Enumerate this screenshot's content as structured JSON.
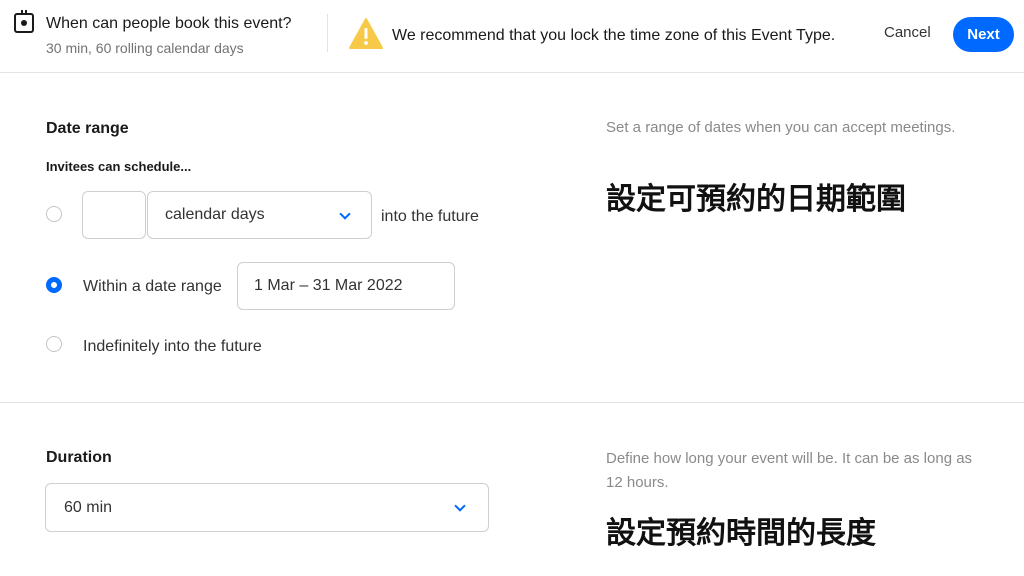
{
  "header": {
    "title": "When can people book this event?",
    "subtitle": "30 min, 60 rolling calendar days",
    "warning": "We recommend that you lock the time zone of this Event Type.",
    "cancel_label": "Cancel",
    "next_label": "Next"
  },
  "date_range": {
    "title": "Date range",
    "invitees_label": "Invitees can schedule...",
    "help": "Set a range of dates when you can accept meetings.",
    "annotation": "設定可預約的日期範圍",
    "options": {
      "rolling": {
        "days_value": "",
        "unit": "calendar days",
        "suffix": "into the future",
        "selected": false
      },
      "within": {
        "label": "Within a date range",
        "range_value": "1 Mar – 31 Mar 2022",
        "selected": true
      },
      "indefinite": {
        "label": "Indefinitely into the future",
        "selected": false
      }
    }
  },
  "duration": {
    "title": "Duration",
    "value": "60 min",
    "help": "Define how long your event will be. It can be as long as 12 hours.",
    "annotation": "設定預約時間的長度"
  },
  "colors": {
    "accent": "#0069ff",
    "warning": "#f7c948"
  },
  "icons": {
    "header": "calendar-icon",
    "warning": "warning-icon",
    "dropdown": "chevron-down-icon"
  }
}
